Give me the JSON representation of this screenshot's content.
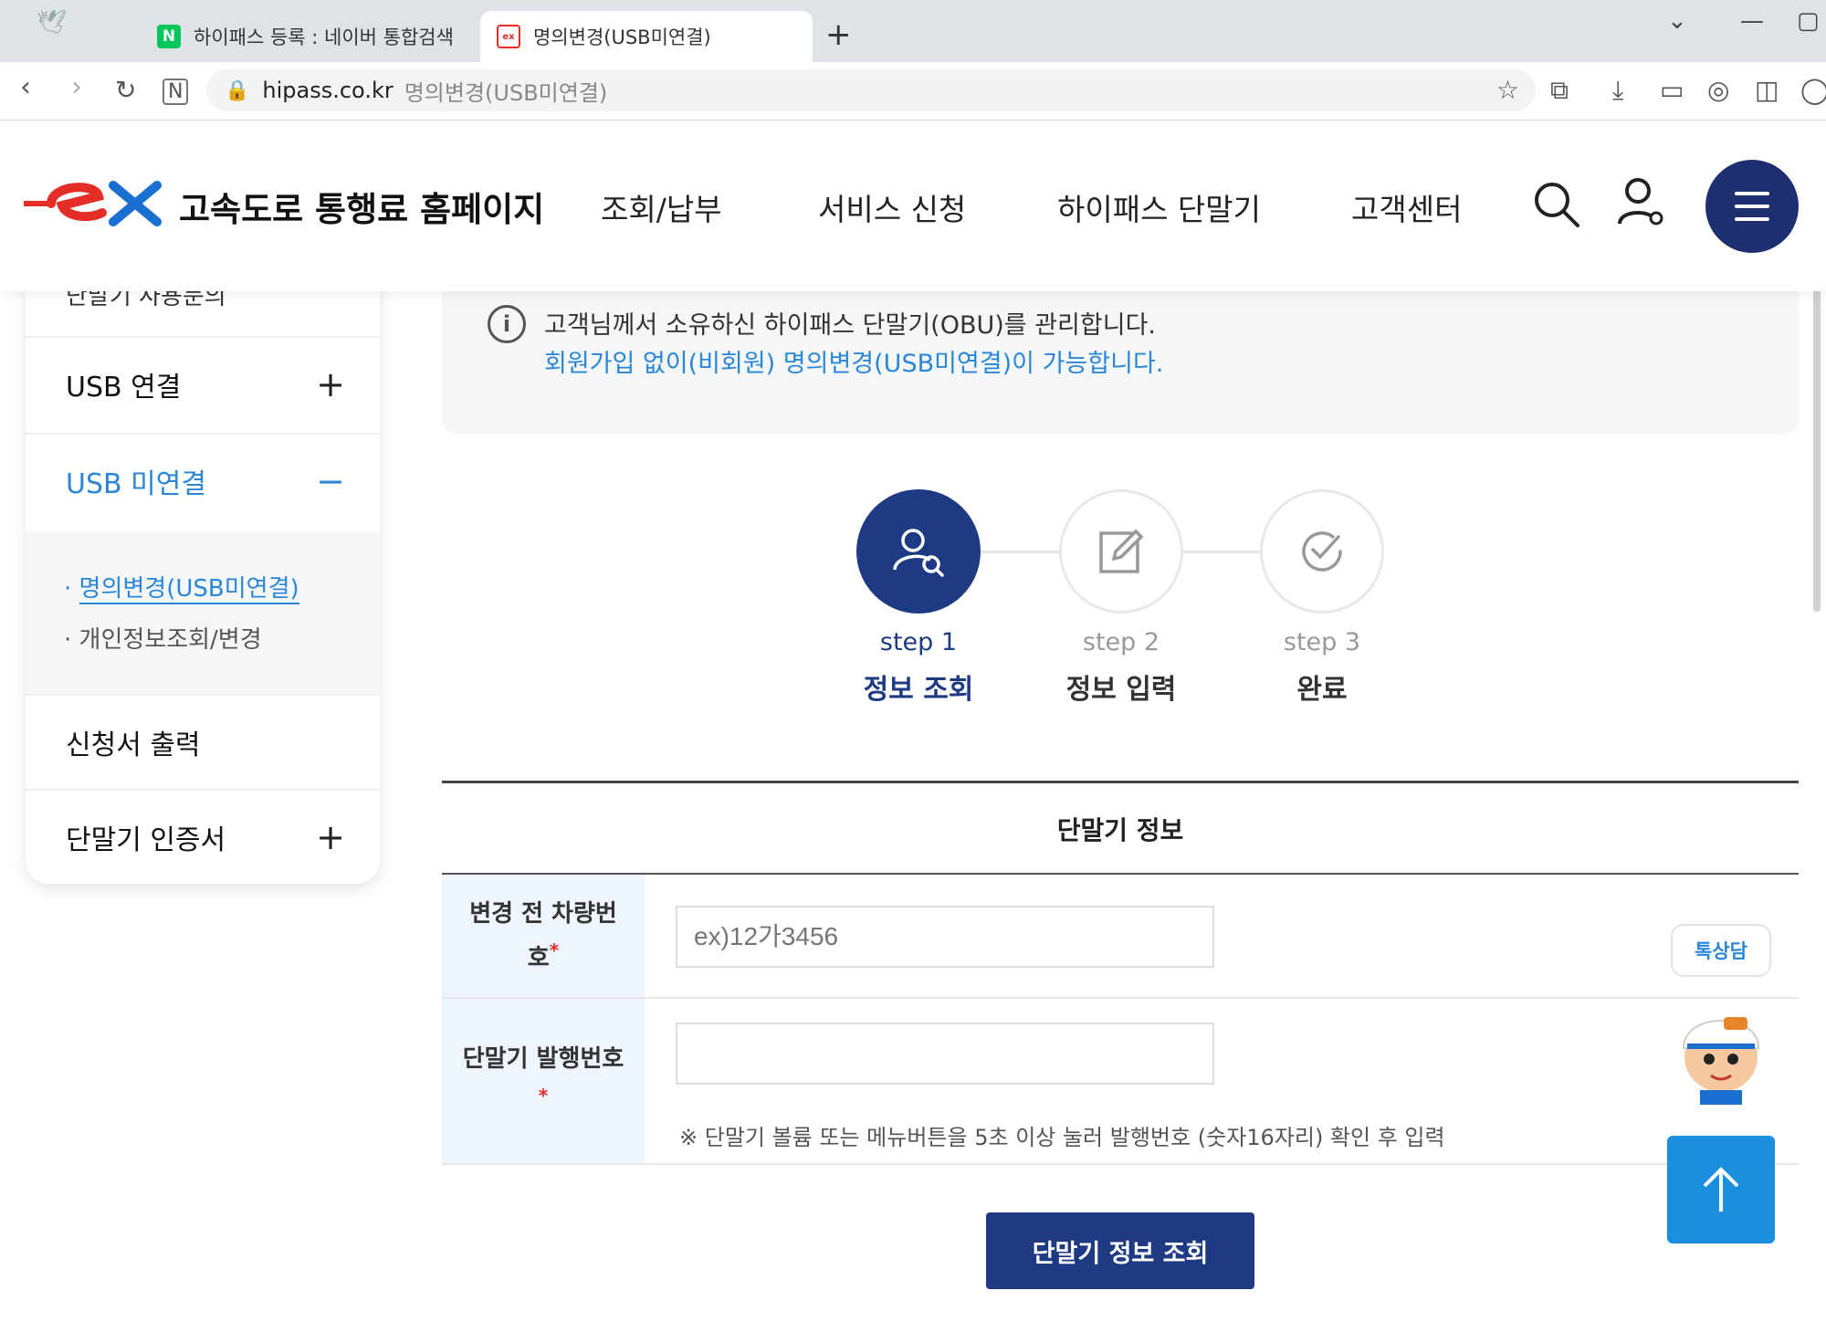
{
  "browser": {
    "tabs": [
      {
        "label": "하이패스 등록 : 네이버 통합검색",
        "favicon": "naver-icon"
      },
      {
        "label": "명의변경(USB미연결)",
        "favicon": "ex-icon"
      }
    ],
    "url_host": "hipass.co.kr",
    "url_path": "명의변경(USB미연결)"
  },
  "header": {
    "logo_text": "고속도로 통행료 홈페이지",
    "nav": [
      "조회/납부",
      "서비스 신청",
      "하이패스 단말기",
      "고객센터"
    ]
  },
  "sidebar": {
    "cut_text": "단말기 사용문의",
    "items": [
      {
        "label": "USB 연결",
        "toggle": "+"
      },
      {
        "label": "USB 미연결",
        "toggle": "−"
      },
      {
        "label": "신청서 출력",
        "toggle": ""
      },
      {
        "label": "단말기 인증서",
        "toggle": "+"
      }
    ],
    "sub_items": [
      "명의변경(USB미연결)",
      "개인정보조회/변경"
    ]
  },
  "notice": {
    "line1": "고객님께서 소유하신 하이패스 단말기(OBU)를 관리합니다.",
    "line2": "회원가입 없이(비회원) 명의변경(USB미연결)이 가능합니다."
  },
  "steps": [
    {
      "num": "step 1",
      "name": "정보 조회",
      "state": "active"
    },
    {
      "num": "step 2",
      "name": "정보 입력",
      "state": "inactive"
    },
    {
      "num": "step 3",
      "name": "완료",
      "state": "inactive"
    }
  ],
  "form": {
    "section_title": "단말기 정보",
    "row1_label": "변경 전 차량번호",
    "row1_placeholder": "ex)12가3456",
    "row2_label": "단말기 발행번호",
    "row2_value": "",
    "row2_note": "※ 단말기 볼륨 또는 메뉴버튼을 5초 이상 눌러 발행번호 (숫자16자리) 확인 후 입력",
    "submit_label": "단말기 정보 조회"
  },
  "floating": {
    "chat_label": "톡상담"
  },
  "colors": {
    "navy": "#1d3a82",
    "accent_blue": "#2a86d6",
    "brand_red": "#e52d27",
    "top_button": "#1a8fe0"
  }
}
